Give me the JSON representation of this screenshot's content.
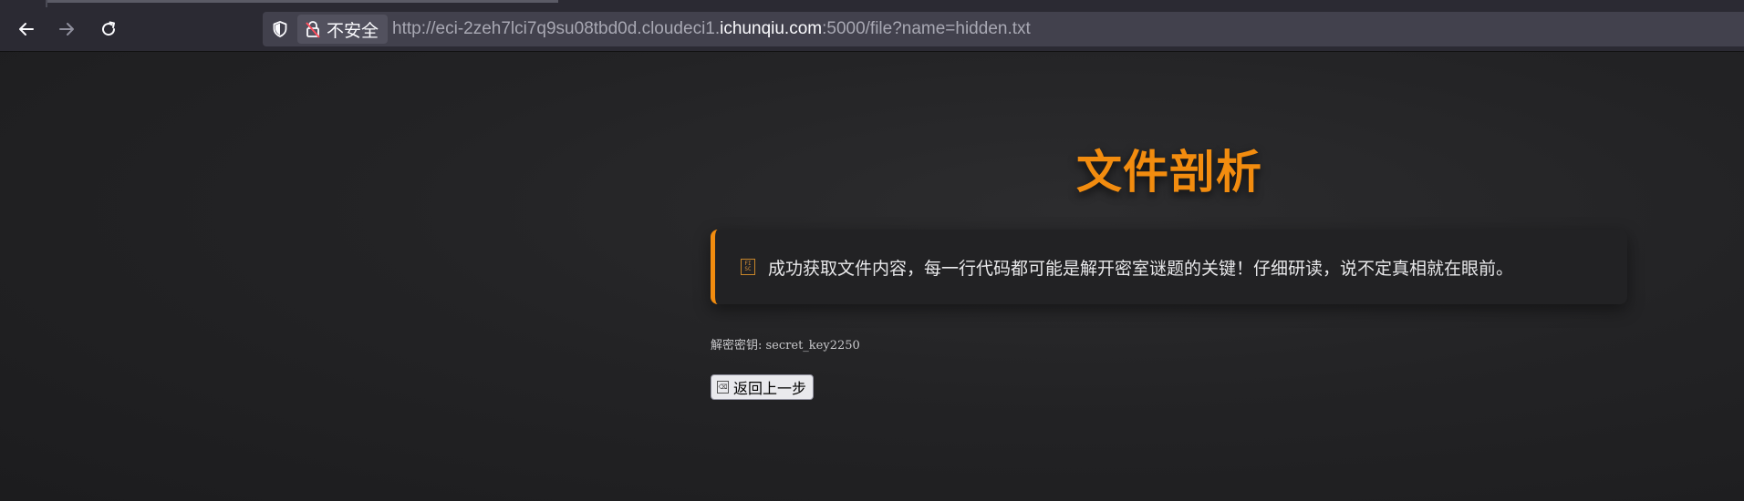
{
  "browser": {
    "back_icon": "arrow-left-icon",
    "forward_icon": "arrow-right-icon",
    "reload_icon": "reload-icon",
    "security_label": "不安全",
    "url": {
      "scheme_prefix": "http://eci-2zeh7lci7q9su08tbd0d.cloudeci1.",
      "host_domain": "ichunqiu.com",
      "suffix": ":5000/file?name=hidden.txt"
    }
  },
  "page": {
    "title": "文件剖析",
    "notice": {
      "icon": "file-icon",
      "text": "成功获取文件内容，每一行代码都可能是解开密室谜题的关键！仔细研读，说不定真相就在眼前。"
    },
    "key_line": "解密密钥: secret_key2250",
    "back_button": {
      "icon": "back-icon",
      "label": "返回上一步"
    }
  },
  "colors": {
    "accent": "#f28c0f",
    "background": "#1e1e20",
    "toolbar": "#2b2a33"
  }
}
